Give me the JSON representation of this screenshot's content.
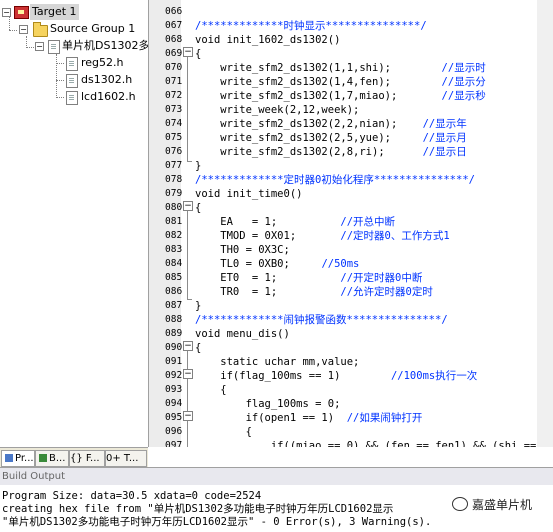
{
  "project": {
    "target": "Target 1",
    "group": "Source Group 1",
    "main_file": "单片机DS1302多",
    "headers": [
      "reg52.h",
      "ds1302.h",
      "lcd1602.h"
    ]
  },
  "project_tabs": [
    "Pr...",
    "B...",
    "{} F...",
    "0+ T..."
  ],
  "editor": {
    "lines": [
      {
        "n": "066",
        "code": "",
        "comment": ""
      },
      {
        "n": "067",
        "code": "",
        "comment": "/*************时钟显示***************/"
      },
      {
        "n": "068",
        "code": "void init_1602_ds1302()",
        "comment": ""
      },
      {
        "n": "069",
        "code": "{",
        "comment": ""
      },
      {
        "n": "070",
        "code": "    write_sfm2_ds1302(1,1,shi);        ",
        "comment": "//显示时"
      },
      {
        "n": "071",
        "code": "    write_sfm2_ds1302(1,4,fen);        ",
        "comment": "//显示分"
      },
      {
        "n": "072",
        "code": "    write_sfm2_ds1302(1,7,miao);       ",
        "comment": "//显示秒"
      },
      {
        "n": "073",
        "code": "    write_week(2,12,week);",
        "comment": ""
      },
      {
        "n": "074",
        "code": "    write_sfm2_ds1302(2,2,nian);    ",
        "comment": "//显示年"
      },
      {
        "n": "075",
        "code": "    write_sfm2_ds1302(2,5,yue);     ",
        "comment": "//显示月"
      },
      {
        "n": "076",
        "code": "    write_sfm2_ds1302(2,8,ri);      ",
        "comment": "//显示日"
      },
      {
        "n": "077",
        "code": "}",
        "comment": ""
      },
      {
        "n": "078",
        "code": "",
        "comment": "/*************定时器0初始化程序***************/"
      },
      {
        "n": "079",
        "code": "void init_time0()",
        "comment": ""
      },
      {
        "n": "080",
        "code": "{",
        "comment": ""
      },
      {
        "n": "081",
        "code": "    EA   = 1;          ",
        "comment": "//开总中断"
      },
      {
        "n": "082",
        "code": "    TMOD = 0X01;       ",
        "comment": "//定时器0、工作方式1"
      },
      {
        "n": "083",
        "code": "    TH0 = 0X3C;",
        "comment": ""
      },
      {
        "n": "084",
        "code": "    TL0 = 0XB0;     ",
        "comment": "//50ms"
      },
      {
        "n": "085",
        "code": "    ET0  = 1;          ",
        "comment": "//开定时器0中断"
      },
      {
        "n": "086",
        "code": "    TR0  = 1;          ",
        "comment": "//允许定时器0定时"
      },
      {
        "n": "087",
        "code": "}",
        "comment": ""
      },
      {
        "n": "088",
        "code": "",
        "comment": "/*************闹钟报警函数***************/"
      },
      {
        "n": "089",
        "code": "void menu_dis()",
        "comment": ""
      },
      {
        "n": "090",
        "code": "{",
        "comment": ""
      },
      {
        "n": "091",
        "code": "    static uchar mm,value;",
        "comment": ""
      },
      {
        "n": "092",
        "code": "    if(flag_100ms == 1)        ",
        "comment": "//100ms执行一次"
      },
      {
        "n": "093",
        "code": "    {",
        "comment": ""
      },
      {
        "n": "094",
        "code": "        flag_100ms = 0;",
        "comment": ""
      },
      {
        "n": "095",
        "code": "        if(open1 == 1)  ",
        "comment": "//如果闹钟打开"
      },
      {
        "n": "096",
        "code": "        {",
        "comment": ""
      },
      {
        "n": "097",
        "code": "            if((miao == 0) && (fen == fen1) && (shi ==",
        "comment": ""
      }
    ]
  },
  "build": {
    "title": "Build Output",
    "lines": [
      "Program Size: data=30.5 xdata=0 code=2524",
      "creating hex file from \"单片机DS1302多功能电子时钟万年历LCD1602显示",
      "\"单片机DS1302多功能电子时钟万年历LCD1602显示\" - 0 Error(s), 3 Warning(s)."
    ]
  },
  "watermark": "嘉盛单片机",
  "colors": {
    "comment": "#0033ff",
    "gutter": "#ececec",
    "selected_target_bg": "#d6d6d6"
  }
}
